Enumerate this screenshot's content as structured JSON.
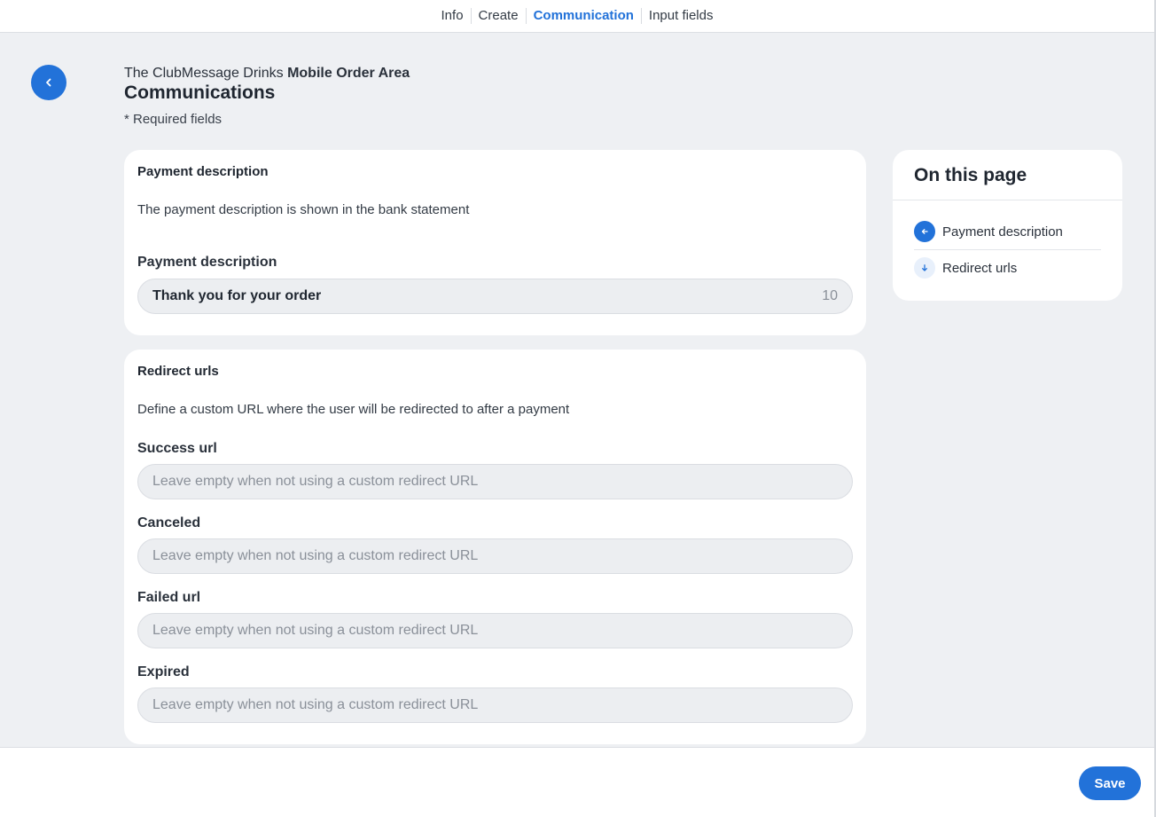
{
  "nav": {
    "tabs": [
      {
        "label": "Info",
        "active": false
      },
      {
        "label": "Create",
        "active": false
      },
      {
        "label": "Communication",
        "active": true
      },
      {
        "label": "Input fields",
        "active": false
      }
    ]
  },
  "header": {
    "org_name": "The ClubMessage Drinks",
    "area_name": "Mobile Order Area",
    "title": "Communications",
    "required_note": "* Required fields"
  },
  "payment_section": {
    "heading": "Payment description",
    "description": "The payment description is shown in the bank statement",
    "field_label": "Payment description",
    "field_value": "Thank you for your order",
    "char_counter": "10"
  },
  "redirect_section": {
    "heading": "Redirect urls",
    "description": "Define a custom URL where the user will be redirected to after a payment",
    "fields": [
      {
        "label": "Success url",
        "value": "",
        "placeholder": "Leave empty when not using a custom redirect URL"
      },
      {
        "label": "Canceled",
        "value": "",
        "placeholder": "Leave empty when not using a custom redirect URL"
      },
      {
        "label": "Failed url",
        "value": "",
        "placeholder": "Leave empty when not using a custom redirect URL"
      },
      {
        "label": "Expired",
        "value": "",
        "placeholder": "Leave empty when not using a custom redirect URL"
      }
    ]
  },
  "toc": {
    "title": "On this page",
    "items": [
      {
        "label": "Payment description",
        "icon": "arrow-left-icon",
        "active": true
      },
      {
        "label": "Redirect urls",
        "icon": "arrow-down-icon",
        "active": false
      }
    ]
  },
  "footer": {
    "save_label": "Save"
  },
  "colors": {
    "accent": "#2272d9",
    "background": "#eef0f3",
    "card": "#ffffff",
    "input_bg": "#eceef1"
  }
}
